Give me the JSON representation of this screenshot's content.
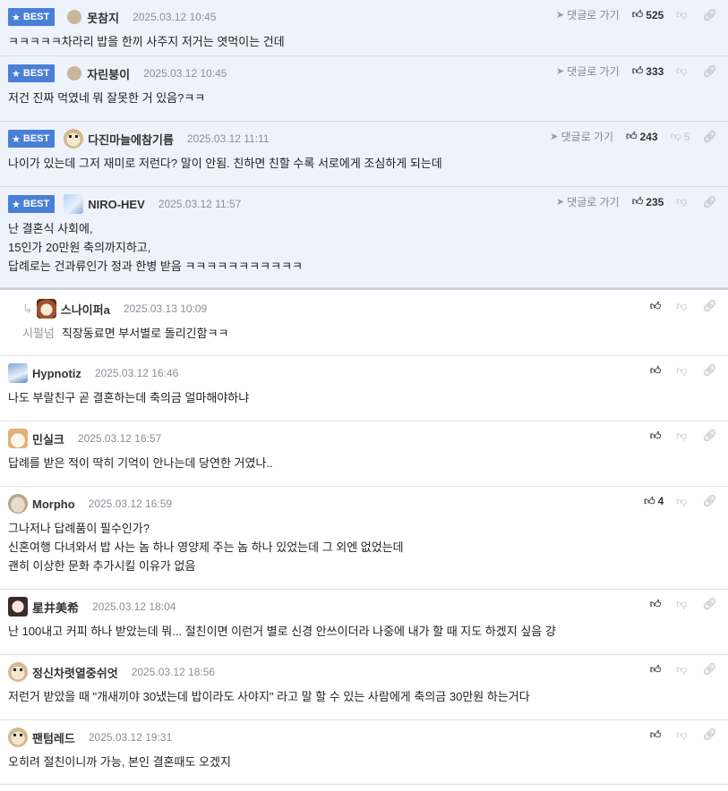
{
  "goto_label": "댓글로 가기",
  "best_label": "BEST",
  "comments": [
    {
      "best": true,
      "avatar": "circle",
      "nick": "못참지",
      "date": "2025.03.12 10:45",
      "up": "525",
      "down": "",
      "lines": [
        "ㅋㅋㅋㅋㅋ차라리 밥을 한끼 사주지 저거는 엿먹이는 건데"
      ]
    },
    {
      "best": true,
      "avatar": "circle",
      "nick": "자린붕이",
      "date": "2025.03.12 10:45",
      "up": "333",
      "down": "",
      "lines": [
        "저건 진짜 먹였네 뭐 잘못한 거 있음?ㅋㅋ"
      ]
    },
    {
      "best": true,
      "avatar": "dog",
      "nick": "다진마늘에참기름",
      "date": "2025.03.12 11:11",
      "up": "243",
      "down": "5",
      "lines": [
        "나이가 있는데 그저 재미로 저런다? 말이 안됨. 친하면 친할 수록 서로에게 조심하게 되는데"
      ]
    },
    {
      "best": true,
      "avatar": "anime",
      "nick": "NIRO-HEV",
      "date": "2025.03.12 11:57",
      "up": "235",
      "down": "",
      "lines": [
        "난 결혼식 사회에,",
        "15인가 20만원 축의까지하고,",
        "답례로는 건과류인가 정과 한병 받음 ㅋㅋㅋㅋㅋㅋㅋㅋㅋㅋㅋ"
      ]
    },
    {
      "reply": true,
      "avatar": "lion",
      "nick": "스나이퍼a",
      "date": "2025.03.13 10:09",
      "up": "",
      "down": "",
      "prefix": "시펄넘",
      "lines": [
        "직장동료면 부서별로 돌리긴함ㅋㅋ"
      ]
    },
    {
      "avatar": "blue",
      "nick": "Hypnotiz",
      "date": "2025.03.12 16:46",
      "up": "",
      "down": "",
      "lines": [
        "나도 부랄친구 곧 결혼하는데 축의금 얼마해야하냐"
      ]
    },
    {
      "avatar": "fox",
      "nick": "민실크",
      "date": "2025.03.12 16:57",
      "up": "",
      "down": "",
      "lines": [
        "답례를 받은 적이 딱히 기억이 안나는데 당연한 거였나.."
      ]
    },
    {
      "avatar": "mouse",
      "nick": "Morpho",
      "date": "2025.03.12 16:59",
      "up": "4",
      "down": "",
      "lines": [
        "그나저나 답례품이 필수인가?",
        "신혼여행 다녀와서 밥 사는 놈 하나 영양제 주는 놈 하나 있었는데 그 외엔 없었는데",
        "괜히 이상한 문화 추가시킬 이유가 없음"
      ]
    },
    {
      "avatar": "girl",
      "nick": "星井美希",
      "date": "2025.03.12 18:04",
      "up": "",
      "down": "",
      "lines": [
        "난 100내고 커피 하나 받았는데 뭐... 절친이면 이런거 별로 신경 안쓰이더라 나중에 내가 할 때 지도 하겠지 싶음 걍"
      ]
    },
    {
      "avatar": "dog",
      "nick": "정신차렷열중쉬엇",
      "date": "2025.03.12 18:56",
      "up": "",
      "down": "",
      "lines": [
        "저런거 받았을 때 \"개새끼야 30냈는데 밥이라도 사야지\" 라고 말 할 수 있는 사람에게 축의금 30만원 하는거다"
      ]
    },
    {
      "avatar": "dog",
      "nick": "팬텀레드",
      "date": "2025.03.12 19:31",
      "up": "",
      "down": "",
      "lines": [
        "오히려 절친이니까 가능, 본인 결혼때도 오겠지"
      ]
    }
  ]
}
